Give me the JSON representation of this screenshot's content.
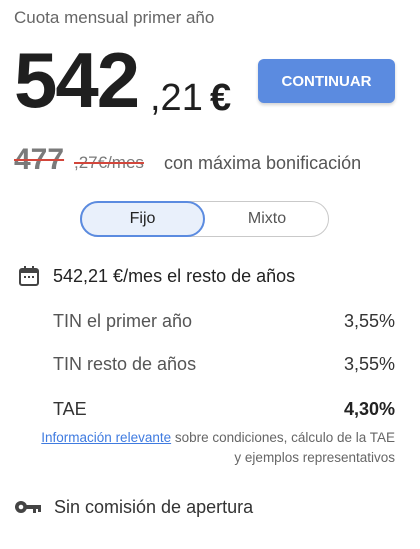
{
  "header": {
    "subtitle": "Cuota mensual primer año",
    "price_integer": "542",
    "price_decimal": ",21",
    "price_currency": "€",
    "continue_label": "CONTINUAR"
  },
  "bonus": {
    "old_integer": "477",
    "old_decimal": ",27€/mes",
    "note": "con máxima bonificación"
  },
  "rate_type": {
    "options": [
      "Fijo",
      "Mixto"
    ],
    "selected": "Fijo"
  },
  "rest_years": {
    "icon": "calendar-icon",
    "text": "542,21 €/mes el resto de años"
  },
  "rates": [
    {
      "label": "TIN el primer año",
      "value": "3,55%"
    },
    {
      "label": "TIN resto de años",
      "value": "3,55%"
    },
    {
      "label": "TAE",
      "value": "4,30%"
    }
  ],
  "info": {
    "link_text": "Información relevante",
    "text": " sobre condiciones, cálculo de la TAE y ejemplos representativos"
  },
  "fee": {
    "icon": "key-icon",
    "text": "Sin comisión de apertura"
  },
  "colors": {
    "accent": "#5b8be0",
    "link": "#3f7be0",
    "strike": "#d2463b",
    "selected_bg": "#e9f0fb"
  }
}
